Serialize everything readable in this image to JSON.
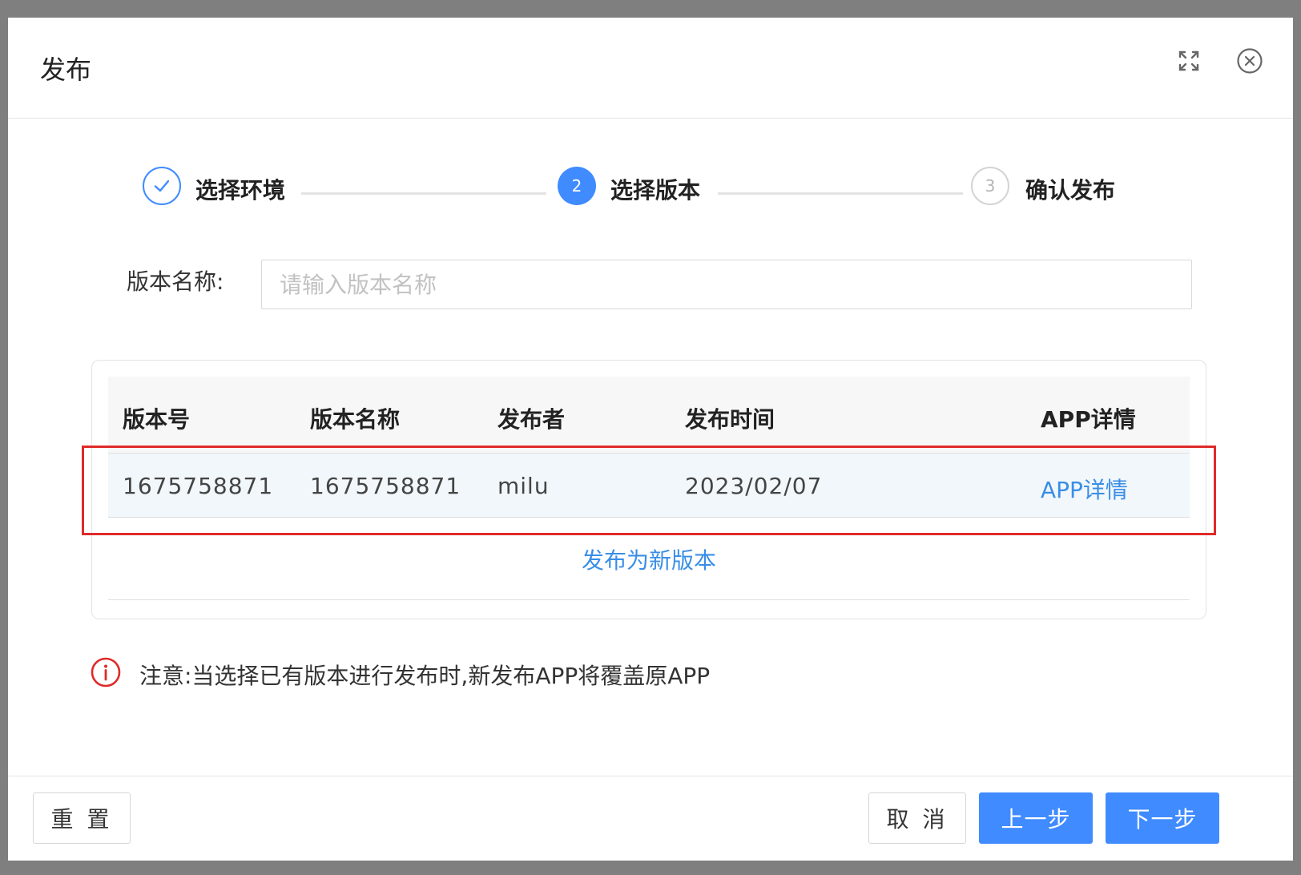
{
  "dialog": {
    "title": "发布"
  },
  "steps": [
    {
      "label": "选择环境",
      "status": "done",
      "number": "1"
    },
    {
      "label": "选择版本",
      "status": "active",
      "number": "2"
    },
    {
      "label": "确认发布",
      "status": "pending",
      "number": "3"
    }
  ],
  "version_name_field": {
    "label": "版本名称:",
    "value": "",
    "placeholder": "请输入版本名称"
  },
  "table": {
    "columns": [
      "版本号",
      "版本名称",
      "发布者",
      "发布时间",
      "APP详情"
    ],
    "rows": [
      {
        "version_number": "1675758871",
        "version_name": "1675758871",
        "publisher": "milu",
        "publish_time": "2023/02/07",
        "details_link": "APP详情"
      }
    ],
    "new_version_link": "发布为新版本"
  },
  "notice": {
    "text": "注意:当选择已有版本进行发布时,新发布APP将覆盖原APP"
  },
  "footer": {
    "reset_label": "重 置",
    "cancel_label": "取 消",
    "prev_label": "上一步",
    "next_label": "下一步"
  },
  "colors": {
    "primary": "#3f8bff",
    "link": "#3a8ee6",
    "highlight": "#e02a2a",
    "notice_icon": "#e02a2a"
  },
  "icons": {
    "expand": "expand-icon",
    "close": "close-icon",
    "step_done": "check-icon",
    "notice": "info-icon"
  }
}
